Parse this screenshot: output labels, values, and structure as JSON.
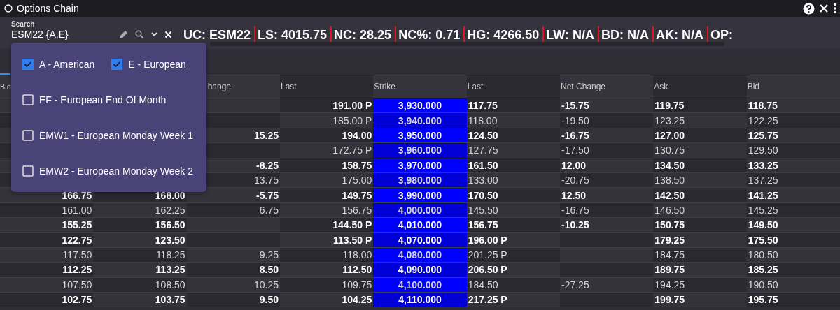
{
  "window": {
    "title": "Options Chain"
  },
  "search": {
    "label": "Search",
    "value": "ESM22 {A,E}"
  },
  "quotes": [
    "UC: ESM22",
    "LS: 4015.75",
    "NC: 28.25",
    "NC%: 0.71",
    "HG: 4266.50",
    "LW: N/A",
    "BD: N/A",
    "AK: N/A",
    "OP:"
  ],
  "dropdown": {
    "options": [
      {
        "label": "A - American",
        "checked": true
      },
      {
        "label": "E - European",
        "checked": true
      },
      {
        "label": "EF - European End Of Month",
        "checked": false
      },
      {
        "label": "EMW1 - European Monday Week 1",
        "checked": false
      },
      {
        "label": "EMW2 - European Monday Week 2",
        "checked": false
      }
    ]
  },
  "table": {
    "columns": [
      {
        "label": "Bid"
      },
      {},
      {
        "label": "hange"
      },
      {
        "label": "Last"
      },
      {
        "label": "Strike"
      },
      {
        "label": "Last"
      },
      {
        "label": "Net Change"
      },
      {
        "label": "Ask"
      },
      {
        "label": "Bid"
      }
    ],
    "rows": [
      {
        "emphasis": true,
        "column_4": "191.00 P",
        "column_5": "3,930.000",
        "column_6": "117.75",
        "column_7": "-15.75",
        "column_8": "119.75",
        "column_9": "118.75"
      },
      {
        "emphasis": false,
        "column_4": "185.00 P",
        "column_5": "3,940.000",
        "column_6": "118.00",
        "column_7": "-19.50",
        "column_8": "123.25",
        "column_9": "122.25"
      },
      {
        "emphasis": true,
        "column_3": "15.25",
        "column_4": "194.00",
        "column_5": "3,950.000",
        "column_6": "124.50",
        "column_7": "-16.75",
        "column_8": "127.00",
        "column_9": "125.75"
      },
      {
        "emphasis": false,
        "column_4": "172.75 P",
        "column_5": "3,960.000",
        "column_6": "127.75",
        "column_7": "-17.50",
        "column_8": "130.75",
        "column_9": "129.50"
      },
      {
        "emphasis": true,
        "column_3": "-8.25",
        "column_4": "158.75",
        "column_5": "3,970.000",
        "column_6": "161.50",
        "column_7": "12.00",
        "column_8": "134.50",
        "column_9": "133.25"
      },
      {
        "emphasis": false,
        "column_3": "13.75",
        "column_4": "175.00",
        "column_5": "3,980.000",
        "column_6": "133.00",
        "column_7": "-20.75",
        "column_8": "138.50",
        "column_9": "137.25"
      },
      {
        "emphasis": true,
        "column_1": "166.75",
        "column_2": "168.00",
        "column_3": "-5.75",
        "column_4": "149.75",
        "column_5": "3,990.000",
        "column_6": "170.50",
        "column_7": "12.50",
        "column_8": "142.50",
        "column_9": "141.25"
      },
      {
        "emphasis": false,
        "column_1": "161.00",
        "column_2": "162.25",
        "column_3": "6.75",
        "column_4": "156.75",
        "column_5": "4,000.000",
        "column_6": "145.50",
        "column_7": "-16.75",
        "column_8": "146.50",
        "column_9": "145.25"
      },
      {
        "emphasis": true,
        "column_1": "155.25",
        "column_2": "156.50",
        "column_4": "144.50 P",
        "column_5": "4,010.000",
        "column_6": "156.75",
        "column_7": "-10.25",
        "column_8": "150.75",
        "column_9": "149.50"
      },
      {
        "emphasis": true,
        "column_1": "122.75",
        "column_2": "123.50",
        "column_4": "113.50 P",
        "column_5": "4,070.000",
        "column_6": "196.00 P",
        "column_8": "179.25",
        "column_9": "175.50"
      },
      {
        "emphasis": false,
        "column_1": "117.50",
        "column_2": "118.25",
        "column_3": "9.25",
        "column_4": "118.00",
        "column_5": "4,080.000",
        "column_6": "201.25 P",
        "column_8": "184.75",
        "column_9": "180.50"
      },
      {
        "emphasis": true,
        "column_1": "112.25",
        "column_2": "113.25",
        "column_3": "8.50",
        "column_4": "112.50",
        "column_5": "4,090.000",
        "column_6": "206.50 P",
        "column_8": "189.75",
        "column_9": "185.25"
      },
      {
        "emphasis": false,
        "column_1": "107.50",
        "column_2": "108.50",
        "column_3": "10.25",
        "column_4": "109.75",
        "column_5": "4,100.000",
        "column_6": "184.50",
        "column_7": "-27.25",
        "column_8": "194.25",
        "column_9": "190.50"
      },
      {
        "emphasis": true,
        "column_1": "102.75",
        "column_2": "103.75",
        "column_3": "9.50",
        "column_4": "104.25",
        "column_5": "4,110.000",
        "column_6": "217.25 P",
        "column_8": "199.75",
        "column_9": "195.75"
      }
    ]
  }
}
